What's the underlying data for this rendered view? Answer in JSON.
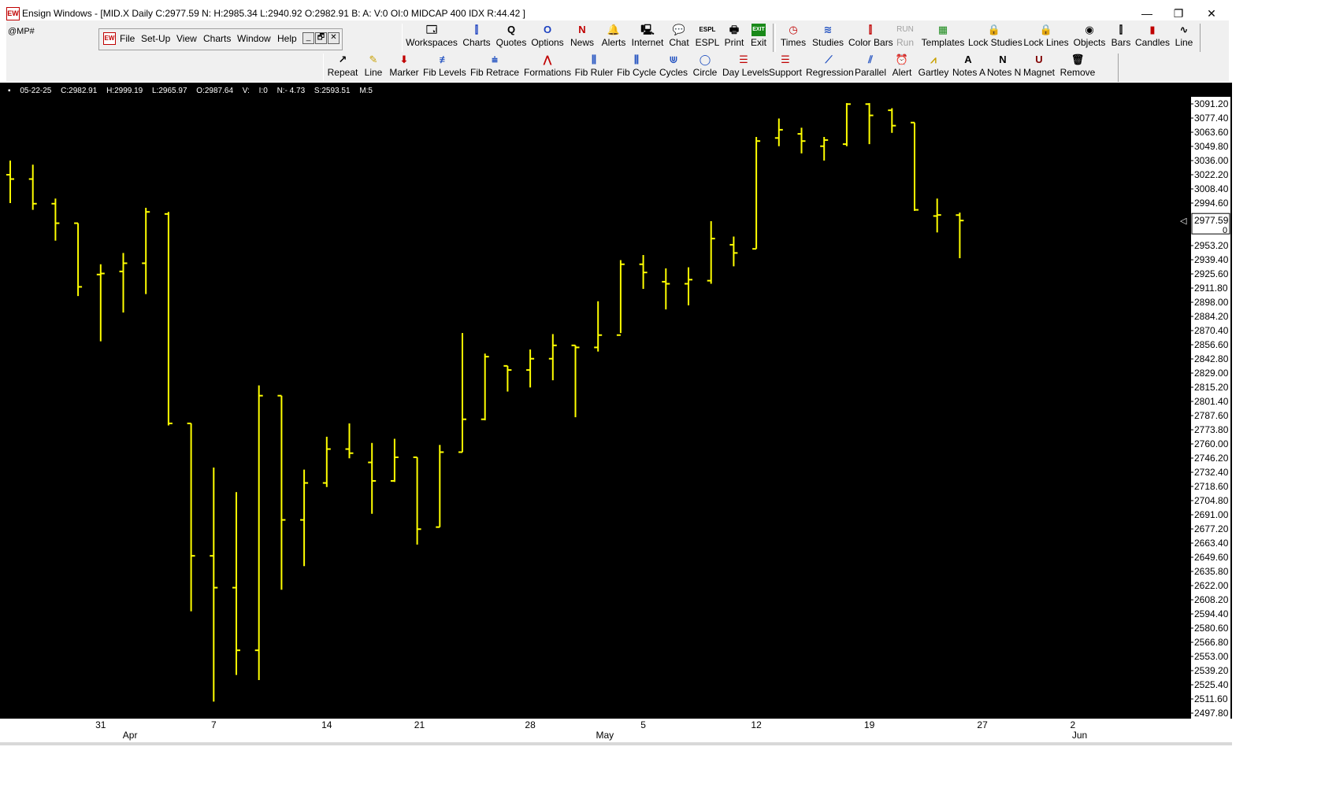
{
  "window": {
    "title": "Ensign Windows - [MID.X Daily C:2977.59 N: H:2985.34 L:2940.92 O:2982.91 B: A: V:0 OI:0 MIDCAP 400 IDX R:44.42 ]",
    "app_icon_text": "EW",
    "minimize": "—",
    "restore": "❐",
    "close": "✕"
  },
  "symbol_field": "@MP#",
  "menu": {
    "items": [
      "File",
      "Set-Up",
      "View",
      "Charts",
      "Window",
      "Help"
    ],
    "child_controls": [
      "_",
      "🗗",
      "✕"
    ]
  },
  "toolbar_top": {
    "group1": [
      {
        "label": "Workspaces",
        "icon": "🗔"
      },
      {
        "label": "Charts",
        "icon": "⫿"
      },
      {
        "label": "Quotes",
        "icon": "Q"
      },
      {
        "label": "Options",
        "icon": "O"
      },
      {
        "label": "News",
        "icon": "N"
      },
      {
        "label": "Alerts",
        "icon": "🔔"
      },
      {
        "label": "Internet",
        "icon": "🖳"
      },
      {
        "label": "Chat",
        "icon": "💬"
      },
      {
        "label": "ESPL",
        "icon": "ESPL"
      },
      {
        "label": "Print",
        "icon": "🖶"
      },
      {
        "label": "Exit",
        "icon": "EXIT"
      }
    ],
    "group2": [
      {
        "label": "Times",
        "icon": "◷"
      },
      {
        "label": "Studies",
        "icon": "≋"
      },
      {
        "label": "Color Bars",
        "icon": "⫿"
      },
      {
        "label": "Run",
        "icon": "RUN",
        "disabled": true
      },
      {
        "label": "Templates",
        "icon": "▦"
      },
      {
        "label": "Lock Studies",
        "icon": "🔒"
      },
      {
        "label": "Lock Lines",
        "icon": "🔒"
      },
      {
        "label": "Objects",
        "icon": "◉"
      },
      {
        "label": "Bars",
        "icon": "⫿"
      },
      {
        "label": "Candles",
        "icon": "▮"
      },
      {
        "label": "Line",
        "icon": "∿"
      }
    ]
  },
  "toolbar_draw": [
    {
      "label": "Repeat",
      "icon": "↗"
    },
    {
      "label": "Line",
      "icon": "✎"
    },
    {
      "label": "Marker",
      "icon": "⬇"
    },
    {
      "label": "Fib Levels",
      "icon": "≢"
    },
    {
      "label": "Fib Retrace",
      "icon": "⩧"
    },
    {
      "label": "Formations",
      "icon": "⋀"
    },
    {
      "label": "Fib Ruler",
      "icon": "⫼"
    },
    {
      "label": "Fib Cycle",
      "icon": "⫼"
    },
    {
      "label": "Cycles",
      "icon": "⋓"
    },
    {
      "label": "Circle",
      "icon": "◯"
    },
    {
      "label": "Day Levels",
      "icon": "☰"
    },
    {
      "label": "Support",
      "icon": "☰"
    },
    {
      "label": "Regression",
      "icon": "⟋"
    },
    {
      "label": "Parallel",
      "icon": "⫽"
    },
    {
      "label": "Alert",
      "icon": "⏰"
    },
    {
      "label": "Gartley",
      "icon": "⩘"
    },
    {
      "label": "Notes  A",
      "icon": "A"
    },
    {
      "label": "Notes  N",
      "icon": "N"
    },
    {
      "label": "Magnet",
      "icon": "U"
    },
    {
      "label": "Remove",
      "icon": "🗑"
    }
  ],
  "infobar": {
    "marker": "▪",
    "date": "05-22-25",
    "close": "C:2982.91",
    "high": "H:2999.19",
    "low": "L:2965.97",
    "open": "O:2987.64",
    "volume": "V:",
    "oi": "I:0",
    "net": "N:- 4.73",
    "s": "S:2593.51",
    "m": "M:5"
  },
  "colors": {
    "bar": "#ffff00",
    "background": "#000000",
    "axis_text": "#000000"
  },
  "chart_data": {
    "type": "ohlc",
    "symbol": "MID.X",
    "interval": "Daily",
    "last_price_label": "2977.59",
    "last_price_sub": "0",
    "y_ticks": [
      "3091.20",
      "3077.40",
      "3063.60",
      "3049.80",
      "3036.00",
      "3022.20",
      "3008.40",
      "2994.60",
      "2953.20",
      "2939.40",
      "2925.60",
      "2911.80",
      "2898.00",
      "2884.20",
      "2870.40",
      "2856.60",
      "2842.80",
      "2829.00",
      "2815.20",
      "2801.40",
      "2787.60",
      "2773.80",
      "2760.00",
      "2746.20",
      "2732.40",
      "2718.60",
      "2704.80",
      "2691.00",
      "2677.20",
      "2663.40",
      "2649.60",
      "2635.80",
      "2622.00",
      "2608.20",
      "2594.40",
      "2580.60",
      "2566.80",
      "2553.00",
      "2539.20",
      "2525.40",
      "2511.60",
      "2497.80"
    ],
    "ylim": [
      2497.8,
      3091.2
    ],
    "x_day_labels": [
      {
        "text": "31",
        "bar": 4.0
      },
      {
        "text": "7",
        "bar": 9.0
      },
      {
        "text": "14",
        "bar": 14.0
      },
      {
        "text": "21",
        "bar": 18.1
      },
      {
        "text": "28",
        "bar": 23.0
      },
      {
        "text": "5",
        "bar": 28.0
      },
      {
        "text": "12",
        "bar": 33.0
      },
      {
        "text": "19",
        "bar": 38.0
      },
      {
        "text": "27",
        "bar": 43.0
      },
      {
        "text": "2",
        "bar": 47.0
      }
    ],
    "x_month_labels": [
      {
        "text": "Apr",
        "bar": 5.3
      },
      {
        "text": "May",
        "bar": 26.3
      },
      {
        "text": "Jun",
        "bar": 47.3
      }
    ],
    "bars": [
      {
        "o": 3022.2,
        "h": 3036.0,
        "l": 2994.6,
        "c": 3018.0
      },
      {
        "o": 3018.0,
        "h": 3032.0,
        "l": 2988.0,
        "c": 2994.0
      },
      {
        "o": 2994.0,
        "h": 2999.0,
        "l": 2958.0,
        "c": 2975.0
      },
      {
        "o": 2975.0,
        "h": 2975.0,
        "l": 2904.0,
        "c": 2913.0
      },
      {
        "o": 2925.0,
        "h": 2935.0,
        "l": 2860.0,
        "c": 2926.0
      },
      {
        "o": 2928.0,
        "h": 2946.0,
        "l": 2888.0,
        "c": 2936.0
      },
      {
        "o": 2936.0,
        "h": 2990.0,
        "l": 2906.0,
        "c": 2986.0
      },
      {
        "o": 2984.0,
        "h": 2986.0,
        "l": 2778.0,
        "c": 2780.0
      },
      {
        "o": 2780.0,
        "h": 2780.0,
        "l": 2597.0,
        "c": 2651.0
      },
      {
        "o": 2651.0,
        "h": 2737.0,
        "l": 2509.0,
        "c": 2620.0
      },
      {
        "o": 2620.0,
        "h": 2713.0,
        "l": 2535.0,
        "c": 2559.0
      },
      {
        "o": 2559.0,
        "h": 2817.0,
        "l": 2530.0,
        "c": 2807.0
      },
      {
        "o": 2807.0,
        "h": 2807.0,
        "l": 2618.0,
        "c": 2686.0
      },
      {
        "o": 2686.0,
        "h": 2735.0,
        "l": 2641.0,
        "c": 2722.0
      },
      {
        "o": 2722.0,
        "h": 2767.0,
        "l": 2718.0,
        "c": 2755.0
      },
      {
        "o": 2755.0,
        "h": 2780.0,
        "l": 2746.0,
        "c": 2751.0
      },
      {
        "o": 2742.0,
        "h": 2761.0,
        "l": 2692.0,
        "c": 2724.0
      },
      {
        "o": 2724.0,
        "h": 2765.0,
        "l": 2723.0,
        "c": 2747.0
      },
      {
        "o": 2747.0,
        "h": 2747.0,
        "l": 2662.0,
        "c": 2677.0
      },
      {
        "o": 2679.0,
        "h": 2759.0,
        "l": 2679.0,
        "c": 2752.0
      },
      {
        "o": 2752.0,
        "h": 2868.0,
        "l": 2752.0,
        "c": 2784.0
      },
      {
        "o": 2784.0,
        "h": 2848.0,
        "l": 2783.0,
        "c": 2845.0
      },
      {
        "o": 2836.0,
        "h": 2836.0,
        "l": 2811.0,
        "c": 2832.0
      },
      {
        "o": 2832.0,
        "h": 2852.0,
        "l": 2815.0,
        "c": 2843.0
      },
      {
        "o": 2843.0,
        "h": 2867.0,
        "l": 2822.0,
        "c": 2856.0
      },
      {
        "o": 2856.0,
        "h": 2856.0,
        "l": 2786.0,
        "c": 2854.0
      },
      {
        "o": 2854.0,
        "h": 2899.0,
        "l": 2850.0,
        "c": 2866.0
      },
      {
        "o": 2866.0,
        "h": 2939.0,
        "l": 2868.0,
        "c": 2935.0
      },
      {
        "o": 2935.0,
        "h": 2944.0,
        "l": 2911.0,
        "c": 2927.0
      },
      {
        "o": 2918.0,
        "h": 2931.0,
        "l": 2891.0,
        "c": 2916.0
      },
      {
        "o": 2916.0,
        "h": 2932.0,
        "l": 2895.0,
        "c": 2920.0
      },
      {
        "o": 2919.0,
        "h": 2977.0,
        "l": 2916.0,
        "c": 2960.0
      },
      {
        "o": 2954.0,
        "h": 2962.0,
        "l": 2933.0,
        "c": 2946.0
      },
      {
        "o": 2950.0,
        "h": 3059.0,
        "l": 2950.0,
        "c": 3055.0
      },
      {
        "o": 3058.0,
        "h": 3077.0,
        "l": 3050.0,
        "c": 3066.0
      },
      {
        "o": 3062.0,
        "h": 3068.0,
        "l": 3043.0,
        "c": 3055.0
      },
      {
        "o": 3050.0,
        "h": 3059.0,
        "l": 3036.0,
        "c": 3056.0
      },
      {
        "o": 3052.0,
        "h": 3092.0,
        "l": 3050.0,
        "c": 3091.0
      },
      {
        "o": 3091.0,
        "h": 3092.0,
        "l": 3052.0,
        "c": 3080.0
      },
      {
        "o": 3085.0,
        "h": 3087.0,
        "l": 3063.0,
        "c": 3070.0
      },
      {
        "o": 3073.0,
        "h": 3073.0,
        "l": 2987.0,
        "c": 2988.0
      },
      {
        "o": 2982.0,
        "h": 2999.0,
        "l": 2966.0,
        "c": 2983.0
      },
      {
        "o": 2982.9,
        "h": 2985.3,
        "l": 2940.9,
        "c": 2977.6
      }
    ],
    "grid": false
  }
}
